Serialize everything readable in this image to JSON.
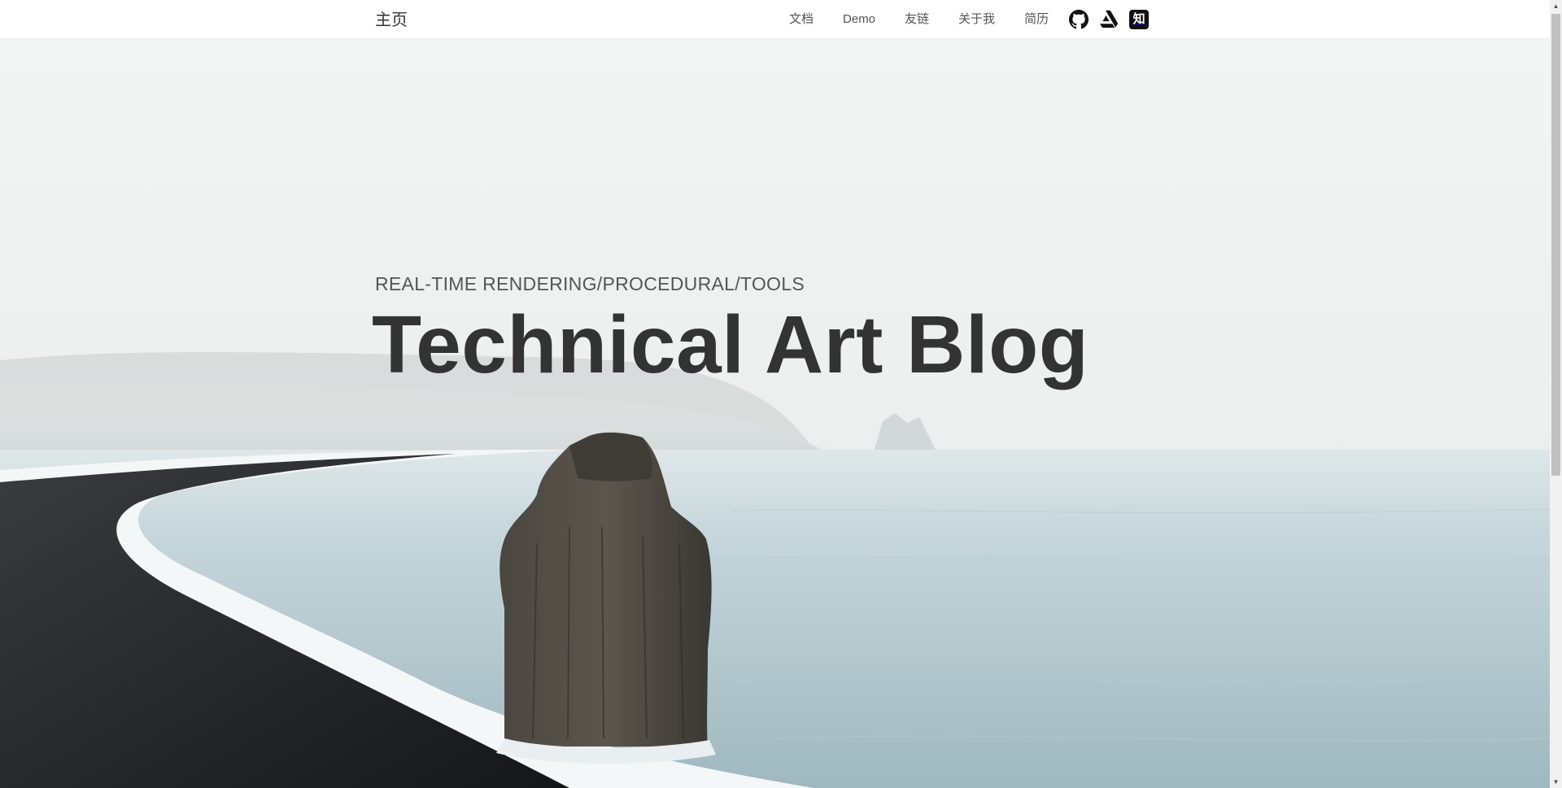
{
  "nav": {
    "brand": "主页",
    "links": [
      "文档",
      "Demo",
      "友链",
      "关于我",
      "简历"
    ],
    "icons": [
      "github-icon",
      "artstation-icon",
      "zhihu-icon"
    ],
    "zhihu_glyph": "知"
  },
  "hero": {
    "subtitle": "REAL-TIME RENDERING/PROCEDURAL/TOOLS",
    "title": "Technical Art Blog"
  },
  "colors": {
    "text_dark": "#333333",
    "text_muted": "#555555",
    "sea": "#a9c2c8",
    "sky": "#eef0f1",
    "sand": "#1d1e22"
  }
}
